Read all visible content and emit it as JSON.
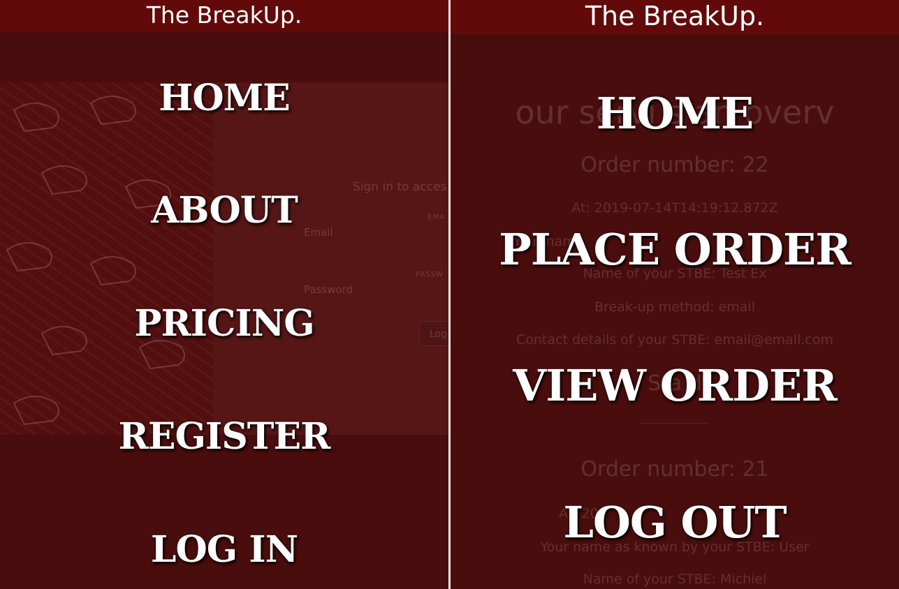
{
  "colors": {
    "overlay": "#4a0d0d",
    "header": "#620a0a",
    "menu_text": "#ffffff",
    "divider": "#f2eaea"
  },
  "left_panel": {
    "header_title": "The BreakUp.",
    "background": {
      "signin_title": "Sign in to acces",
      "email_label": "EMA",
      "email_placeholder": "Email",
      "password_label": "PASSW",
      "password_placeholder": "Password",
      "login_button": "Log"
    },
    "menu": [
      {
        "label": "HOME"
      },
      {
        "label": "ABOUT"
      },
      {
        "label": "PRICING"
      },
      {
        "label": "REGISTER"
      },
      {
        "label": "LOG IN"
      }
    ]
  },
  "right_panel": {
    "header_title": "The BreakUp.",
    "background": {
      "heading": "our servi          s an overv",
      "order1_number": "Order number: 22",
      "order1_at": "At: 2019-07-14T14:19:12.872Z",
      "order1_name_partial": "Your nam",
      "order1_stbe_name": "Name of your STBE: Test Ex",
      "order1_method": "Break-up method: email",
      "order1_contact": "Contact details of your STBE: email@email.com",
      "order1_status_partial": "Sta                                           d",
      "separator": "——————————",
      "order2_number": "Order number: 21",
      "order2_at_partial": "At: 20",
      "order2_name": "Your name as known by your STBE: User",
      "order2_stbe_name": "Name of your STBE: Michiel"
    },
    "menu": [
      {
        "label": "HOME"
      },
      {
        "label": "PLACE ORDER"
      },
      {
        "label": "VIEW ORDER"
      },
      {
        "label": "LOG OUT"
      }
    ]
  }
}
